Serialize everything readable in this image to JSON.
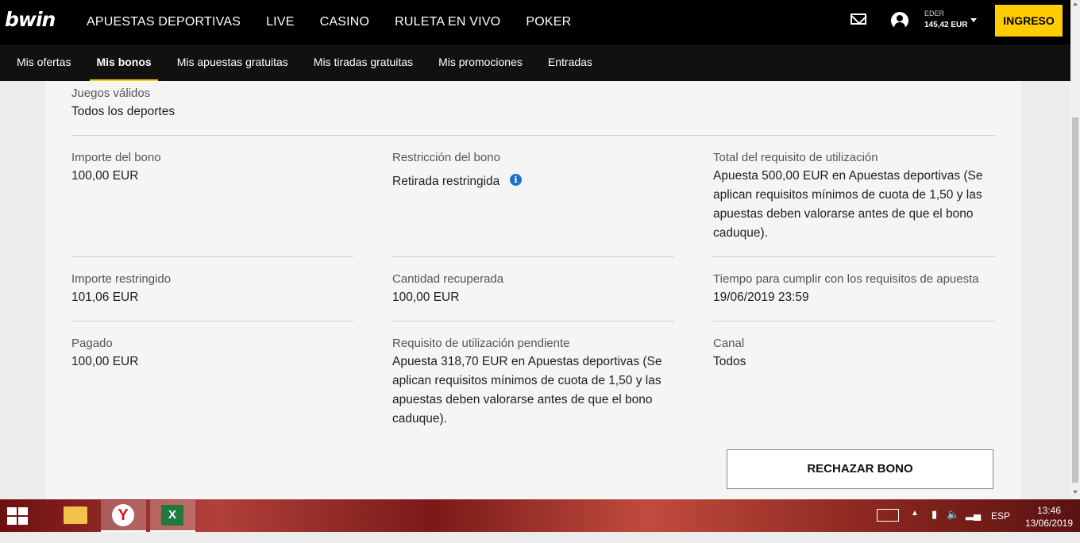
{
  "header": {
    "logo": "bwin",
    "nav": [
      "APUESTAS DEPORTIVAS",
      "LIVE",
      "CASINO",
      "RULETA EN VIVO",
      "POKER"
    ],
    "user_name": "EDER",
    "balance": "145,42 EUR",
    "login_label": "INGRESO"
  },
  "subnav": {
    "items": [
      "Mis ofertas",
      "Mis bonos",
      "Mis apuestas gratuitas",
      "Mis tiradas gratuitas",
      "Mis promociones",
      "Entradas"
    ],
    "active": "Mis bonos"
  },
  "bonus": {
    "valid_games_label": "Juegos válidos",
    "valid_games_value": "Todos los deportes",
    "amount_label": "Importe del bono",
    "amount_value": "100,00 EUR",
    "restriction_label": "Restricción del bono",
    "restriction_value": "Retirada restringida",
    "total_req_label": "Total del requisito de utilización",
    "total_req_value": "Apuesta 500,00 EUR en Apuestas deportivas (Se aplican requisitos mínimos de cuota de 1,50 y las apuestas deben valorarse antes de que el bono caduque).",
    "restricted_label": "Importe restringido",
    "restricted_value": "101,06 EUR",
    "recovered_label": "Cantidad recuperada",
    "recovered_value": "100,00 EUR",
    "time_label": "Tiempo para cumplir con los requisitos de apuesta",
    "time_value": "19/06/2019 23:59",
    "paid_label": "Pagado",
    "paid_value": "100,00 EUR",
    "pending_label": "Requisito de utilización pendiente",
    "pending_value": "Apuesta 318,70 EUR en Apuestas deportivas (Se aplican requisitos mínimos de cuota de 1,50 y las apuestas deben valorarse antes de que el bono caduque).",
    "channel_label": "Canal",
    "channel_value": "Todos",
    "reject_label": "RECHAZAR BONO"
  },
  "taskbar": {
    "lang": "ESP",
    "time": "13:46",
    "date": "13/06/2019"
  }
}
